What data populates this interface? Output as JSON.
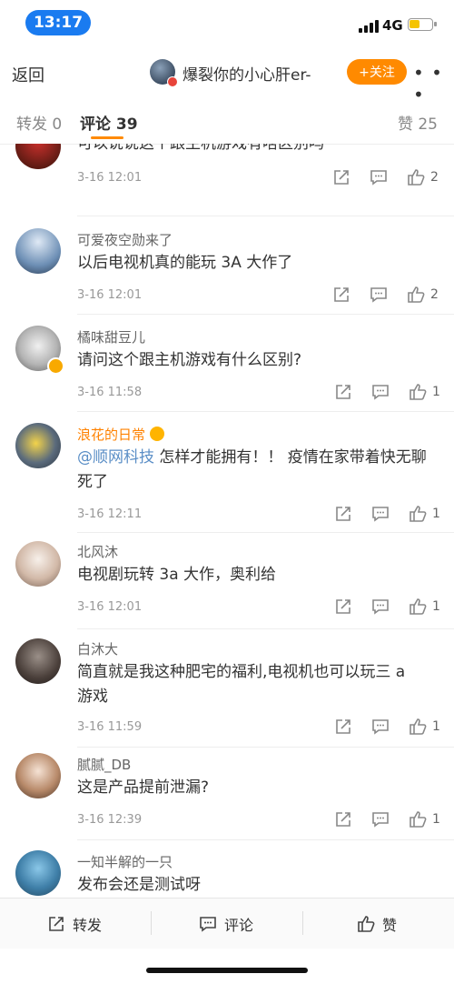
{
  "status_bar": {
    "time": "13:17",
    "network": "4G",
    "battery_level": 0.35
  },
  "nav": {
    "back_label": "返回",
    "title": "爆裂你的小心肝er-",
    "follow_label": "+关注",
    "more_label": "• • •"
  },
  "tabs": {
    "repost_label": "转发",
    "repost_count": "0",
    "comment_label": "评论",
    "comment_count": "39",
    "like_label": "赞",
    "like_count": "25"
  },
  "comments": [
    {
      "name": "",
      "text": "可以说说这个跟主机游戏有啥区别吗",
      "time": "3-16 12:01",
      "likes": "2"
    },
    {
      "name": "可爱夜空勋来了",
      "text": "以后电视机真的能玩 3A 大作了",
      "time": "3-16 12:01",
      "likes": "2"
    },
    {
      "name": "橘味甜豆儿",
      "text": "请问这个跟主机游戏有什么区别?",
      "time": "3-16 11:58",
      "likes": "1"
    },
    {
      "name": "浪花的日常",
      "mention": "@顺网科技",
      "text": " 怎样才能拥有！！ 疫情在家带着快无聊死了",
      "time": "3-16 12:11",
      "likes": "1"
    },
    {
      "name": "北风沐",
      "text": "电视剧玩转 3a 大作，奥利给",
      "time": "3-16 12:01",
      "likes": "1"
    },
    {
      "name": "白沐大",
      "text": "简直就是我这种肥宅的福利,电视机也可以玩三 a 游戏",
      "time": "3-16 11:59",
      "likes": "1"
    },
    {
      "name": "腻腻_DB",
      "text": "这是产品提前泄漏?",
      "time": "3-16 12:39",
      "likes": "1"
    },
    {
      "name": "一知半解的一只",
      "text": "发布会还是测试呀",
      "time": "",
      "likes": ""
    }
  ],
  "bottom_bar": {
    "repost_label": "转发",
    "comment_label": "评论",
    "like_label": "赞"
  },
  "colors": {
    "accent": "#ff8a00",
    "time_pill": "#1a7bf0",
    "mention": "#5a8ec6",
    "vip_name": "#ff8200"
  }
}
